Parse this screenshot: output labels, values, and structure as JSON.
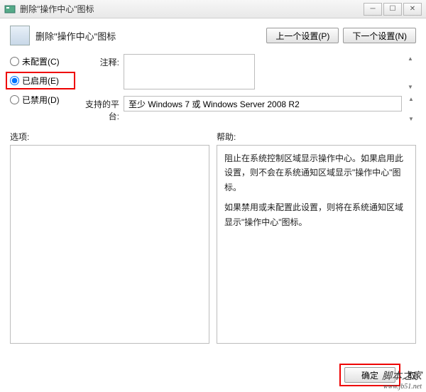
{
  "window": {
    "title": "删除\"操作中心\"图标",
    "min_tip": "最小化",
    "max_tip": "最大化",
    "close_tip": "关闭"
  },
  "header": {
    "title": "删除\"操作中心\"图标",
    "prev_btn": "上一个设置(P)",
    "next_btn": "下一个设置(N)"
  },
  "radios": {
    "not_configured": "未配置(C)",
    "enabled": "已启用(E)",
    "disabled": "已禁用(D)",
    "selected": "enabled"
  },
  "fields": {
    "comment_label": "注释:",
    "comment_value": "",
    "platform_label": "支持的平台:",
    "platform_value": "至少 Windows 7 或 Windows Server 2008 R2"
  },
  "split": {
    "options_label": "选项:",
    "help_label": "帮助:",
    "help_p1": "阻止在系统控制区域显示操作中心。如果启用此设置，则不会在系统通知区域显示\"操作中心\"图标。",
    "help_p2": "如果禁用或未配置此设置，则将在系统通知区域显示\"操作中心\"图标。"
  },
  "footer": {
    "ok": "确定",
    "cancel_partial": "取"
  },
  "watermark": {
    "line1": "脚本之家",
    "line2": "www.jb51.net"
  }
}
